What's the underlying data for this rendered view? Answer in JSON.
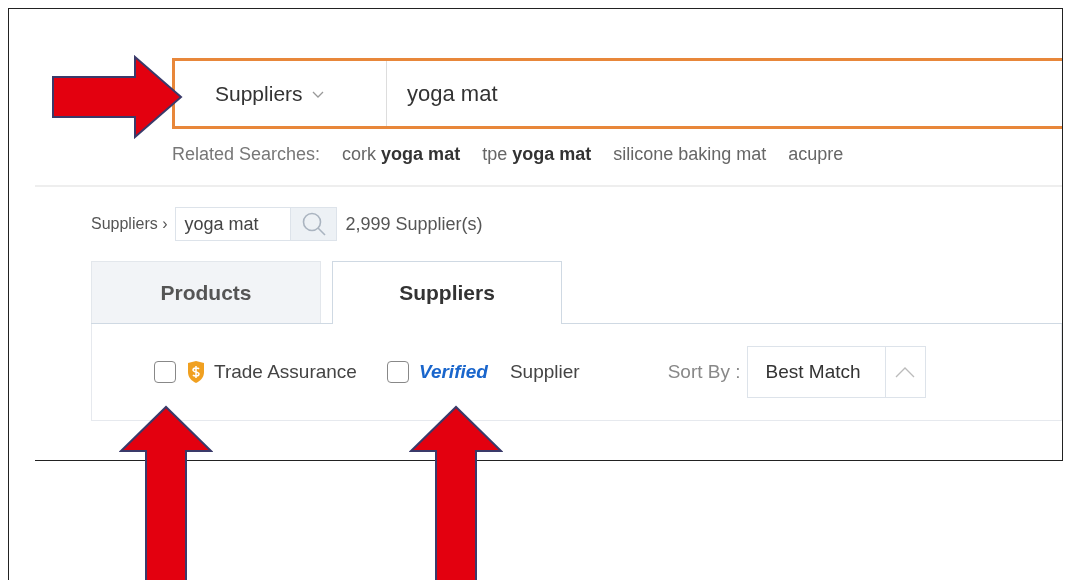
{
  "search": {
    "category": "Suppliers",
    "value": "yoga mat"
  },
  "related": {
    "label": "Related Searches:",
    "items": [
      "cork **yoga mat**",
      "tpe **yoga mat**",
      "silicone baking mat",
      "acupre"
    ]
  },
  "breadcrumb": {
    "link": "Suppliers ›",
    "query": "yoga mat",
    "count": "2,999 Supplier(s)"
  },
  "tabs": [
    {
      "label": "Products",
      "selected": false
    },
    {
      "label": "Suppliers",
      "selected": true
    }
  ],
  "filters": [
    {
      "kind": "trade",
      "checked": false,
      "label": "Trade Assurance"
    },
    {
      "kind": "verified",
      "checked": false,
      "badge": "Verified",
      "label": "Supplier"
    }
  ],
  "sort": {
    "label": "Sort By :",
    "value": "Best Match"
  },
  "arrows": [
    {
      "kind": "right"
    },
    {
      "kind": "up"
    },
    {
      "kind": "up"
    }
  ]
}
